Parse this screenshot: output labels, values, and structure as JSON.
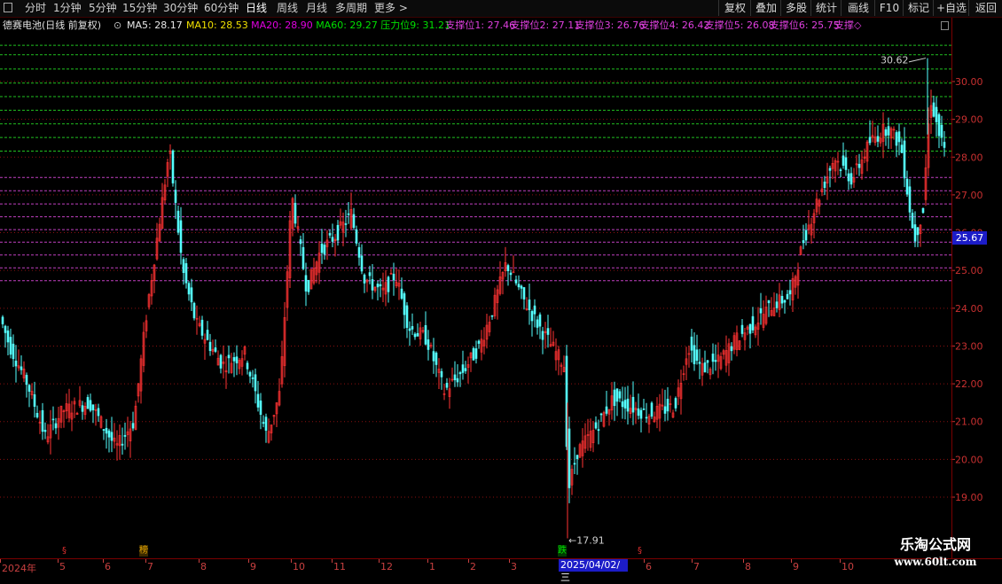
{
  "toolbar": {
    "tabs": [
      "分时",
      "1分钟",
      "5分钟",
      "15分钟",
      "30分钟",
      "60分钟",
      "日线",
      "周线",
      "月线",
      "多周期",
      "更多 >"
    ],
    "active_tab": "日线",
    "right_buttons": [
      "复权",
      "叠加",
      "多股",
      "统计",
      "画线",
      "F10",
      "标记",
      "+自选",
      "返回"
    ]
  },
  "info": {
    "title": "德赛电池(日线 前复权)",
    "items": [
      {
        "text": "MA5: 28.17",
        "color": "#e8e8e8"
      },
      {
        "text": "MA10: 28.53",
        "color": "#f0e000"
      },
      {
        "text": "MA20: 28.90",
        "color": "#e000e0"
      },
      {
        "text": "MA60: 29.27",
        "color": "#00e000"
      },
      {
        "text": "压力位9: 31.21",
        "color": "#00e000"
      },
      {
        "text": "支撑位1: 27.46",
        "color": "#e040e0"
      },
      {
        "text": "支撑位2: 27.11",
        "color": "#e040e0"
      },
      {
        "text": "支撑位3: 26.76",
        "color": "#e040e0"
      },
      {
        "text": "支撑位4: 26.42",
        "color": "#e040e0"
      },
      {
        "text": "支撑位5: 26.08",
        "color": "#e040e0"
      },
      {
        "text": "支撑位6: 25.75",
        "color": "#e040e0"
      },
      {
        "text": "支撑◇",
        "color": "#e040e0"
      }
    ]
  },
  "chart_data": {
    "type": "candlestick",
    "y_axis": {
      "ticks": [
        19.0,
        20.0,
        21.0,
        22.0,
        23.0,
        24.0,
        25.0,
        26.0,
        27.0,
        28.0,
        29.0,
        30.0
      ],
      "range": [
        18.0,
        31.3
      ],
      "position": "right"
    },
    "pressure_levels": [
      30.96,
      30.71,
      30.33,
      29.96,
      29.6,
      29.24,
      28.88,
      28.52,
      28.16
    ],
    "support_levels": [
      27.46,
      27.11,
      26.76,
      26.42,
      26.08,
      25.75,
      25.41,
      25.07,
      24.73
    ],
    "grid": "dotted red at ticks",
    "high_marker": "30.62",
    "low_marker": "←17.91",
    "current_price": "25.67",
    "months": [
      "2024年",
      "5",
      "6",
      "7",
      "8",
      "9",
      "10",
      "11",
      "12",
      "1",
      "2",
      "3",
      "4",
      "6",
      "7",
      "8",
      "9",
      "10"
    ],
    "selected_date": "2025/04/02/三",
    "events": [
      {
        "text": "§",
        "color": "#e03030"
      },
      {
        "text": "榜",
        "color": "#e0a000"
      },
      {
        "text": "跌",
        "color": "#00e000"
      },
      {
        "text": "§",
        "color": "#e03030"
      }
    ],
    "up_color": "#ff3333",
    "down_color": "#54ffff"
  },
  "watermark": {
    "title": "乐淘公式网",
    "url": "www.60lt.com"
  }
}
